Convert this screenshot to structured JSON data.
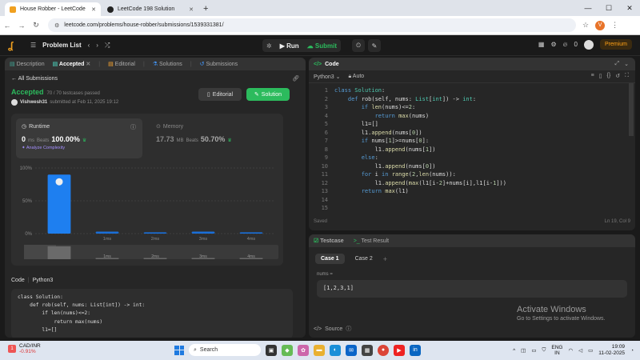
{
  "browser": {
    "tabs": [
      {
        "title": "House Robber - LeetCode",
        "active": true,
        "favicon_color": "#f0a020"
      },
      {
        "title": "LeetCode 198 Solution",
        "active": false,
        "favicon_color": "#222222"
      }
    ],
    "url": "leetcode.com/problems/house-robber/submissions/1539331381/",
    "profile_initial": "V"
  },
  "header": {
    "problem_list": "Problem List",
    "run": "Run",
    "submit": "Submit",
    "streak": "0",
    "premium": "Premium"
  },
  "left": {
    "tabs": [
      "Description",
      "Accepted",
      "Editorial",
      "Solutions",
      "Submissions"
    ],
    "all_submissions": "All Submissions",
    "status": "Accepted",
    "testcases": "70 / 70 testcases passed",
    "user": "Vishwesh31",
    "submitted": "submitted at Feb 11, 2025 19:12",
    "editorial_btn": "Editorial",
    "solution_btn": "Solution",
    "runtime": {
      "label": "Runtime",
      "value": "0",
      "unit": "ms",
      "beats_label": "Beats",
      "beats": "100.00%",
      "analyze": "Analyze Complexity"
    },
    "memory": {
      "label": "Memory",
      "value": "17.73",
      "unit": "MB",
      "beats_label": "Beats",
      "beats": "50.70%"
    },
    "code_label": "Code",
    "code_lang": "Python3",
    "code_preview": "class Solution:\n    def rob(self, nums: List[int]) -> int:\n        if len(nums)<=2:\n            return max(nums)\n        l1=[]"
  },
  "chart_data": {
    "type": "bar",
    "categories": [
      "0ms",
      "1ms",
      "2ms",
      "3ms",
      "4ms"
    ],
    "values": [
      90,
      3,
      2,
      3,
      2
    ],
    "y_ticks": [
      "100%",
      "50%",
      "0%"
    ],
    "ylim": [
      0,
      100
    ],
    "highlight": "0ms"
  },
  "code_panel": {
    "title": "Code",
    "lang": "Python3",
    "mode": "Auto",
    "lines": [
      "class Solution:",
      "    def rob(self, nums: List[int]) -> int:",
      "        if len(nums)<=2:",
      "            return max(nums)",
      "        l1=[]",
      "        l1.append(nums[0])",
      "        if nums[1]>=nums[0]:",
      "            l1.append(nums[1])",
      "        else:",
      "            l1.append(nums[0])",
      "        for i in range(2,len(nums)):",
      "            l1.append(max(l1[i-2]+nums[i],l1[i-1]))",
      "        return max(l1)",
      "",
      ""
    ],
    "saved": "Saved",
    "cursor": "Ln 19, Col 9"
  },
  "testcase": {
    "tab": "Testcase",
    "result_tab": "Test Result",
    "cases": [
      "Case 1",
      "Case 2"
    ],
    "input_label": "nums =",
    "input_value": "[1,2,3,1]",
    "source": "Source"
  },
  "watermark": {
    "title": "Activate Windows",
    "subtitle": "Go to Settings to activate Windows."
  },
  "taskbar": {
    "stock_name": "CAD/INR",
    "stock_change": "-0.91%",
    "search": "Search",
    "lang1": "ENG",
    "lang2": "IN",
    "time": "19:09",
    "date": "11-02-2025"
  }
}
